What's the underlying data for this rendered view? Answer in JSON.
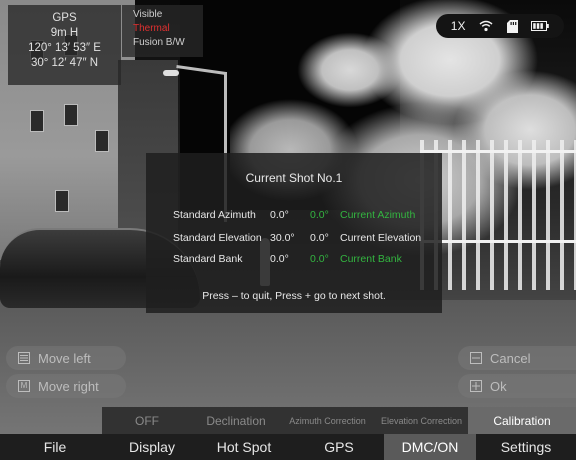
{
  "gps": {
    "title": "GPS",
    "altitude": "9m H",
    "longitude": "120° 13′ 53″ E",
    "latitude": "30° 12′ 47″ N"
  },
  "image_modes": {
    "items": [
      "Visible",
      "Thermal",
      "Fusion B/W"
    ],
    "active": "Thermal",
    "active_color": "#e03030"
  },
  "status": {
    "zoom": "1X",
    "icons": [
      "wifi-icon",
      "sd-card-icon",
      "battery-icon"
    ]
  },
  "dialog": {
    "title": "Current Shot No.1",
    "rows": [
      {
        "label": "Standard Azimuth",
        "standard": "0.0°",
        "current": "0.0°",
        "current_label": "Current Azimuth",
        "highlight": true
      },
      {
        "label": "Standard Elevation",
        "standard": "30.0°",
        "current": "0.0°",
        "current_label": "Current Elevation",
        "highlight": false
      },
      {
        "label": "Standard Bank",
        "standard": "0.0°",
        "current": "0.0°",
        "current_label": "Current Bank",
        "highlight": true
      }
    ],
    "highlight_color": "#33b540",
    "footer": "Press – to quit, Press + go to next shot."
  },
  "controls": {
    "move_left": "Move left",
    "move_right": "Move right",
    "cancel": "Cancel",
    "ok": "Ok"
  },
  "sub_menu": {
    "items": [
      "OFF",
      "Declination",
      "Azimuth Correction",
      "Elevation Correction",
      "Calibration"
    ],
    "active": "Calibration"
  },
  "main_menu": {
    "items": [
      "File",
      "Display",
      "Hot Spot",
      "GPS",
      "DMC/ON",
      "Settings"
    ],
    "active": "DMC/ON"
  }
}
